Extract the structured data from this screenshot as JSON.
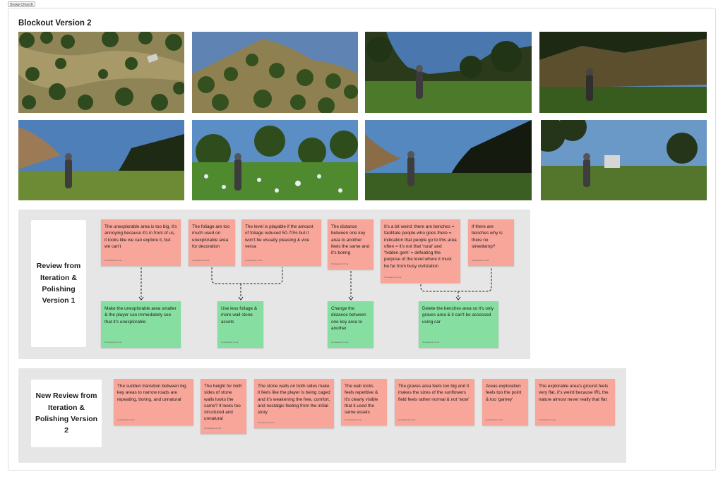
{
  "frame_tag": "Snow Church",
  "section_title": "Blockout Version 2",
  "colors": {
    "sticky_red": "#f8a59a",
    "sticky_green": "#86dfa1",
    "panel_bg": "#e6e6e6"
  },
  "screenshots": [
    {
      "name": "topdown-forest-overview",
      "scene": "top"
    },
    {
      "name": "hillside-aerial-view",
      "scene": "hill"
    },
    {
      "name": "character-forest-clearing",
      "scene": "char"
    },
    {
      "name": "character-shadowed-canyon",
      "scene": "dark"
    },
    {
      "name": "character-rocky-valley",
      "scene": "rock"
    },
    {
      "name": "character-sunflower-field",
      "scene": "flower"
    },
    {
      "name": "character-dark-cliff",
      "scene": "cliff"
    },
    {
      "name": "character-building-view",
      "scene": "house"
    }
  ],
  "review1": {
    "label": "Review from Iteration & Polishing Version 1",
    "author": "Nurhasanah Umar",
    "feedback": [
      "The unexplorable area is too big, it's annoying because it's in front of us, it looks like we can explore it, but we can't",
      "The foliage are too much used on unexplorable area for decoration",
      "The level is playable if the amount of foliage reduced 50-70% but it won't be visually pleasing & vice versa",
      "The distance between one key area to another feels the same and it's boring",
      "It's a bit weird: there are benches = facilitate people who goes there = indication that people go to this area often = it's not that 'rural' and 'hidden gem' = defeating the purpose of the level where it must be far from busy civilization",
      "If there are benches why is there no streetlamp?"
    ],
    "solutions": [
      "Make the unexplorable area smaller & the player can immediately see that it's unexplorable",
      "Use less foliage & more wall stone assets",
      "Change the distance between one key area to another",
      "Delete the benches area so it's only graves area & it can't be accessed using car"
    ]
  },
  "review2": {
    "label": "New Review from Iteration & Polishing Version 2",
    "author": "Nurhasanah Umar",
    "feedback": [
      "The sudden transition between big key areas to narrow roads are repeating, boring, and unnatural",
      "The height for both sides of stone walls looks the same? It looks too structured and unnatural",
      "The stone walls on both sides make it feels like the player is being caged and it's weakening the free, comfort, and nostalgic feeling from the initial story",
      "The wall rocks feels repetitive & it's clearly visible that it used the same assets",
      "The graves area feels too big and it makes the sizes of the sunflowers field feels rather normal & not 'wow'",
      "Areas exploration feels too the point & too 'gamey'",
      "The explorable area's ground feels very flat, it's weird because IRL the nature almost never really that flat"
    ]
  }
}
